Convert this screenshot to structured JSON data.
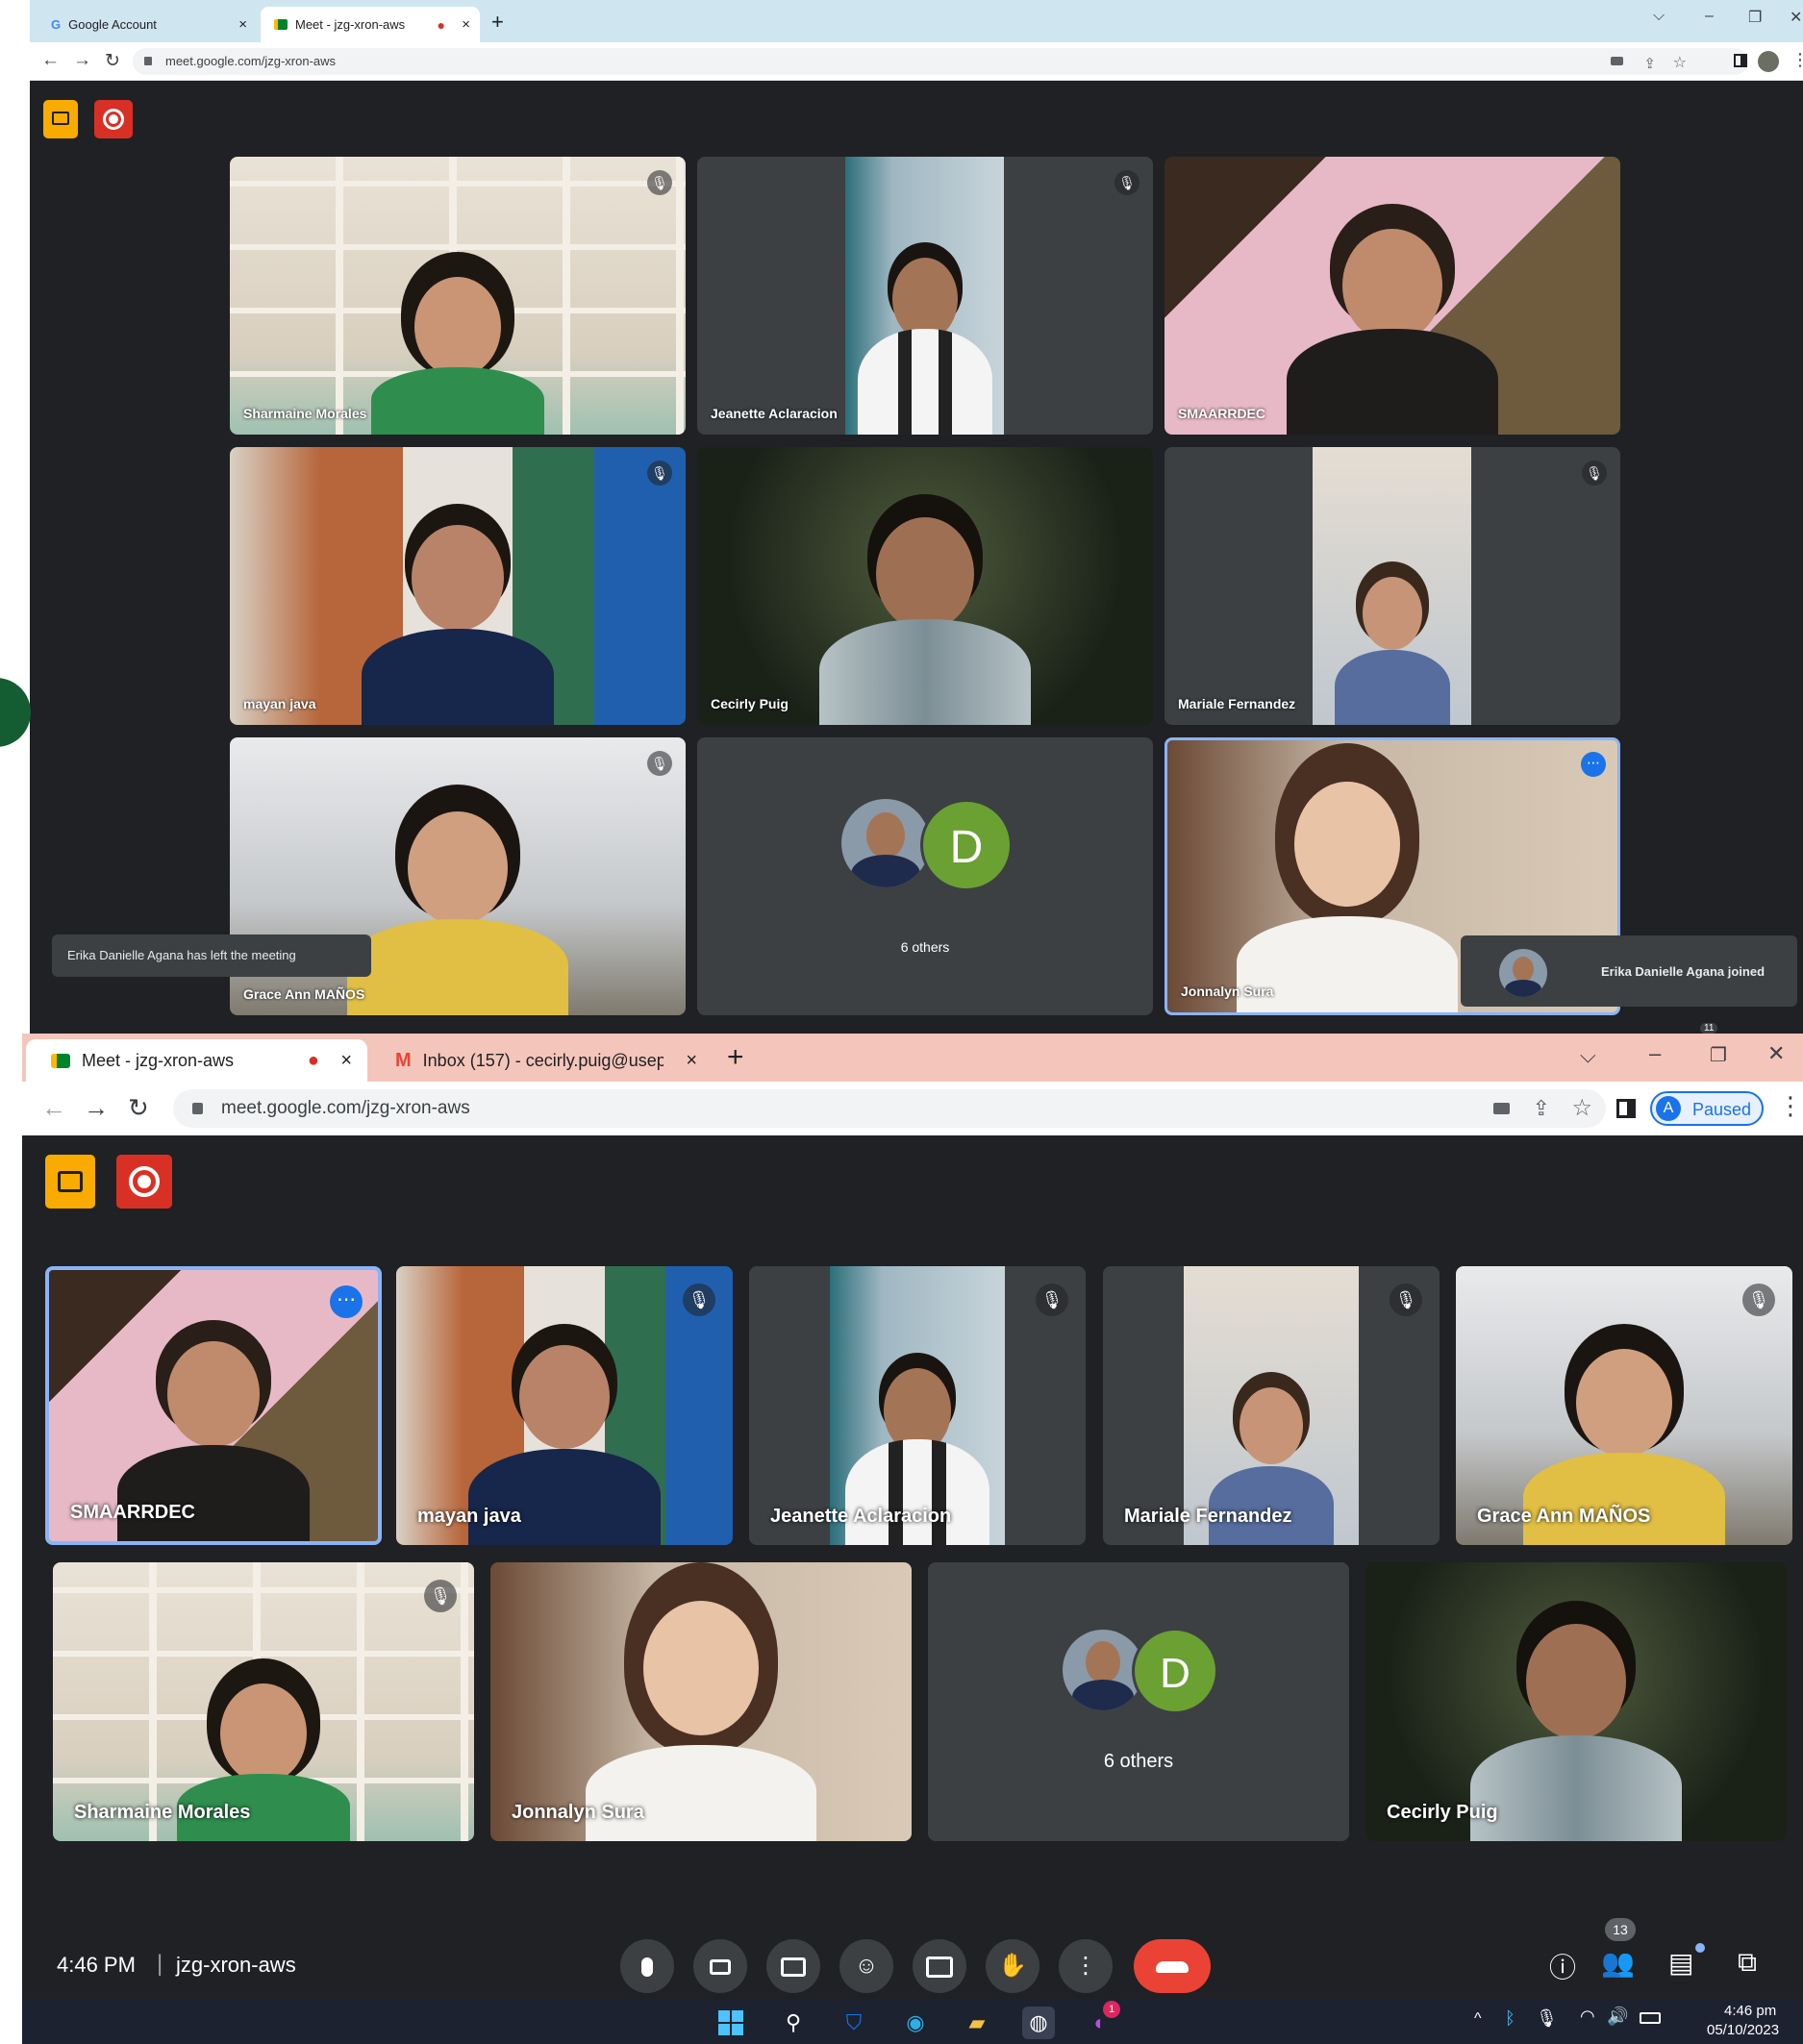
{
  "top_window": {
    "tabs": [
      {
        "favicon": "google-g-icon",
        "title": "Google Account",
        "close": "×"
      },
      {
        "favicon": "meet-icon",
        "title": "Meet - jzg-xron-aws",
        "recording_dot": "●",
        "close": "×"
      }
    ],
    "new_tab": "+",
    "window_controls": [
      "⌵",
      "–",
      "❐",
      "✕"
    ],
    "nav": [
      "←",
      "→",
      "↻"
    ],
    "url": "meet.google.com/jzg-xron-aws",
    "tiles": [
      {
        "name": "Sharmaine Morales",
        "muted": true
      },
      {
        "name": "Jeanette Aclaracion",
        "muted": true
      },
      {
        "name": "SMAARRDEC",
        "muted": false
      },
      {
        "name": "mayan java",
        "muted": true
      },
      {
        "name": "Cecirly Puig",
        "muted": false
      },
      {
        "name": "Mariale Fernandez",
        "muted": true
      },
      {
        "name": "Grace Ann MAÑOS",
        "muted": true
      },
      {
        "name": "6 others",
        "avatar_letter": "D",
        "muted": false
      },
      {
        "name": "Jonnalyn Sura",
        "muted": false,
        "active": true
      }
    ],
    "left_toast": "Erika Danielle Agana has left the meeting",
    "right_toast": "Erika Danielle Agana joined",
    "corner_badge": "11"
  },
  "bottom_window": {
    "tabs": [
      {
        "favicon": "meet-icon",
        "title": "Meet - jzg-xron-aws",
        "recording_dot": "●",
        "close": "×"
      },
      {
        "favicon": "gmail-icon",
        "title": "Inbox (157) - cecirly.puig@usep",
        "close": "×"
      }
    ],
    "new_tab": "+",
    "window_controls": [
      "⌵",
      "–",
      "❐",
      "✕"
    ],
    "nav": [
      "←",
      "→",
      "↻"
    ],
    "url": "meet.google.com/jzg-xron-aws",
    "profile_letter": "A",
    "profile_status": "Paused",
    "tiles": [
      {
        "name": "SMAARRDEC",
        "muted": false,
        "active": true
      },
      {
        "name": "mayan java",
        "muted": true
      },
      {
        "name": "Jeanette Aclaracion",
        "muted": true
      },
      {
        "name": "Mariale Fernandez",
        "muted": true
      },
      {
        "name": "Grace Ann MAÑOS",
        "muted": true
      },
      {
        "name": "Sharmaine Morales",
        "muted": true
      },
      {
        "name": "Jonnalyn Sura",
        "muted": false
      },
      {
        "name": "6 others",
        "avatar_letter": "D",
        "muted": false
      },
      {
        "name": "Cecirly Puig",
        "muted": false
      }
    ],
    "time": "4:46 PM",
    "separator": "|",
    "meeting_code": "jzg-xron-aws",
    "people_count": "13",
    "taskbar_badge": "1",
    "clock_time": "4:46 pm",
    "clock_date": "05/10/2023"
  },
  "colors": {
    "meet_bg": "#202124",
    "tile_bg": "#3c4043",
    "end_call": "#ea4335",
    "active_border": "#8ab4f8",
    "avatar_green": "#6aa132",
    "top_tabbar": "#cfe6f1",
    "bottom_tabbar": "#f4c5bb"
  }
}
